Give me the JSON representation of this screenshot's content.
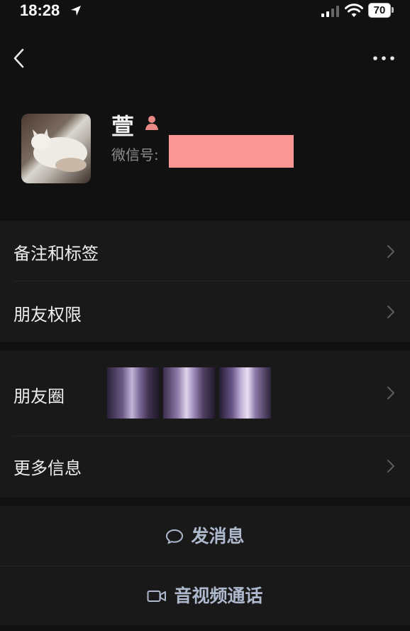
{
  "status_bar": {
    "time": "18:28",
    "battery": "70"
  },
  "nav": {
    "back_icon": "chevron-left-icon",
    "more_icon": "more-horizontal-icon"
  },
  "profile": {
    "name": "萱",
    "gender_icon": "female-person-icon",
    "wechat_id_label": "微信号:",
    "wechat_id_redacted_color": "#fa9794"
  },
  "menu": {
    "remark_tags": "备注和标签",
    "friend_permissions": "朋友权限",
    "moments": "朋友圈",
    "more_info": "更多信息"
  },
  "actions": {
    "send_message": "发消息",
    "video_call": "音视频通话"
  },
  "colors": {
    "background": "#111111",
    "card": "#191919",
    "action_text": "#aeb9cd",
    "gender_icon": "#e98a86"
  }
}
